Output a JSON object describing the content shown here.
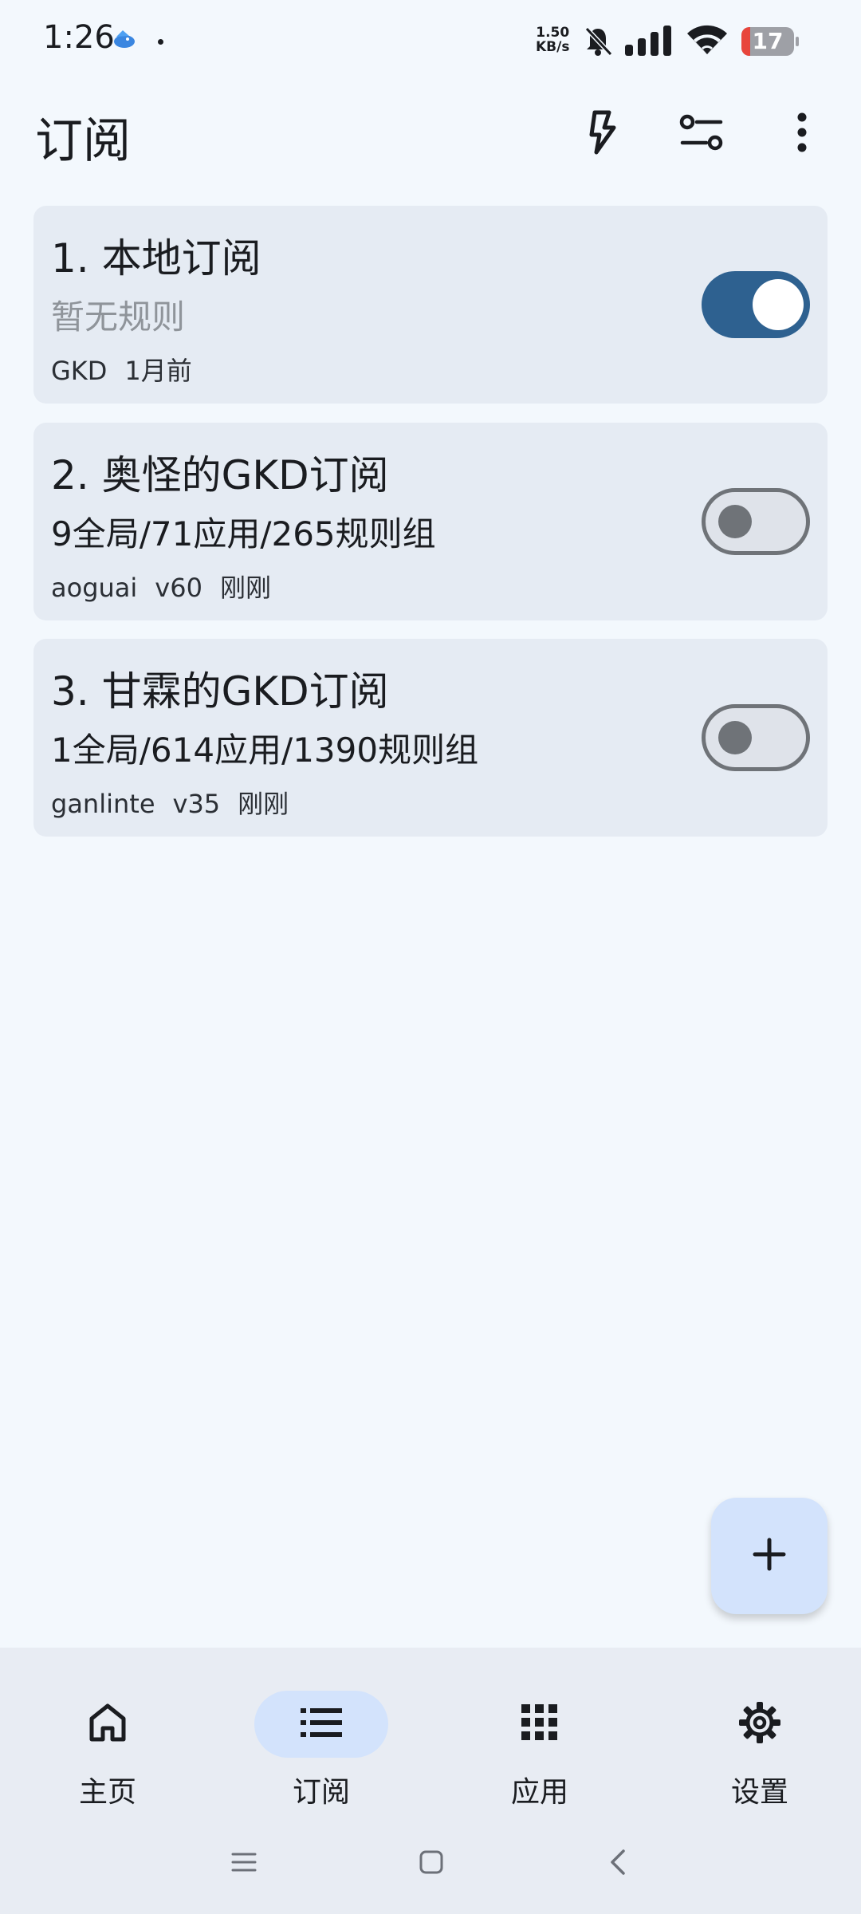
{
  "status_bar": {
    "time": "1:26",
    "net_speed_value": "1.50",
    "net_speed_unit": "KB/s",
    "battery_level": "17",
    "battery_fraction": 0.17
  },
  "app_bar": {
    "title": "订阅",
    "actions": [
      "flash-icon",
      "tune-icon",
      "more-vert-icon"
    ]
  },
  "subscriptions": [
    {
      "title": "1. 本地订阅",
      "summary": "暂无规则",
      "author": "GKD",
      "version": "",
      "updated": "1月前",
      "enabled": true
    },
    {
      "title": "2. 奥怪的GKD订阅",
      "summary": "9全局/71应用/265规则组",
      "author": "aoguai",
      "version": "v60",
      "updated": "刚刚",
      "enabled": false
    },
    {
      "title": "3. 甘霖的GKD订阅",
      "summary": "1全局/614应用/1390规则组",
      "author": "ganlinte",
      "version": "v35",
      "updated": "刚刚",
      "enabled": false
    }
  ],
  "fab": {
    "icon": "add-icon"
  },
  "bottom_nav": {
    "items": [
      {
        "label": "主页",
        "icon": "home-icon",
        "active": false
      },
      {
        "label": "订阅",
        "icon": "list-icon",
        "active": true
      },
      {
        "label": "应用",
        "icon": "apps-icon",
        "active": false
      },
      {
        "label": "设置",
        "icon": "settings-icon",
        "active": false
      }
    ]
  },
  "colors": {
    "background": "#f3f8fd",
    "card": "#e5ebf3",
    "switch_on": "#2e6190",
    "switch_off_track": "#dfe3ea",
    "switch_off_outline": "#6f7378",
    "fab": "#d3e3fc",
    "nav_active_pill": "#d3e3fc",
    "battery_low": "#e8453c"
  }
}
